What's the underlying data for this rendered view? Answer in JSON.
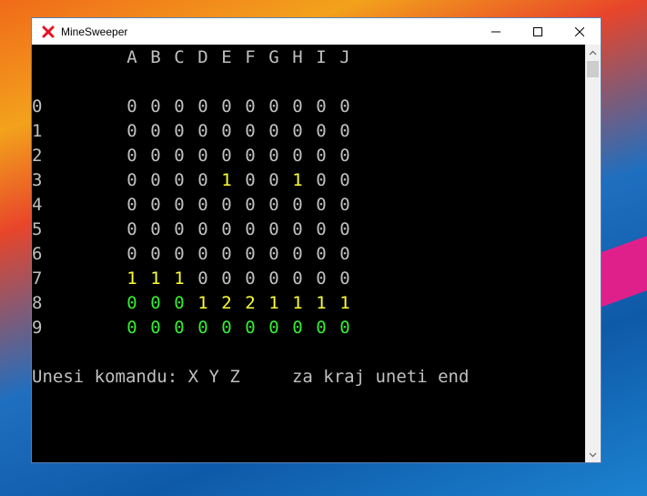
{
  "window": {
    "title": "MineSweeper"
  },
  "columns": [
    "A",
    "B",
    "C",
    "D",
    "E",
    "F",
    "G",
    "H",
    "I",
    "J"
  ],
  "rows": [
    {
      "label": "0",
      "cells": [
        [
          "0",
          "g"
        ],
        [
          "0",
          "g"
        ],
        [
          "0",
          "g"
        ],
        [
          "0",
          "g"
        ],
        [
          "0",
          "g"
        ],
        [
          "0",
          "g"
        ],
        [
          "0",
          "g"
        ],
        [
          "0",
          "g"
        ],
        [
          "0",
          "g"
        ],
        [
          "0",
          "g"
        ]
      ]
    },
    {
      "label": "1",
      "cells": [
        [
          "0",
          "g"
        ],
        [
          "0",
          "g"
        ],
        [
          "0",
          "g"
        ],
        [
          "0",
          "g"
        ],
        [
          "0",
          "g"
        ],
        [
          "0",
          "g"
        ],
        [
          "0",
          "g"
        ],
        [
          "0",
          "g"
        ],
        [
          "0",
          "g"
        ],
        [
          "0",
          "g"
        ]
      ]
    },
    {
      "label": "2",
      "cells": [
        [
          "0",
          "g"
        ],
        [
          "0",
          "g"
        ],
        [
          "0",
          "g"
        ],
        [
          "0",
          "g"
        ],
        [
          "0",
          "g"
        ],
        [
          "0",
          "g"
        ],
        [
          "0",
          "g"
        ],
        [
          "0",
          "g"
        ],
        [
          "0",
          "g"
        ],
        [
          "0",
          "g"
        ]
      ]
    },
    {
      "label": "3",
      "cells": [
        [
          "0",
          "g"
        ],
        [
          "0",
          "g"
        ],
        [
          "0",
          "g"
        ],
        [
          "0",
          "g"
        ],
        [
          "1",
          "y"
        ],
        [
          "0",
          "g"
        ],
        [
          "0",
          "g"
        ],
        [
          "1",
          "y"
        ],
        [
          "0",
          "g"
        ],
        [
          "0",
          "g"
        ]
      ]
    },
    {
      "label": "4",
      "cells": [
        [
          "0",
          "g"
        ],
        [
          "0",
          "g"
        ],
        [
          "0",
          "g"
        ],
        [
          "0",
          "g"
        ],
        [
          "0",
          "g"
        ],
        [
          "0",
          "g"
        ],
        [
          "0",
          "g"
        ],
        [
          "0",
          "g"
        ],
        [
          "0",
          "g"
        ],
        [
          "0",
          "g"
        ]
      ]
    },
    {
      "label": "5",
      "cells": [
        [
          "0",
          "g"
        ],
        [
          "0",
          "g"
        ],
        [
          "0",
          "g"
        ],
        [
          "0",
          "g"
        ],
        [
          "0",
          "g"
        ],
        [
          "0",
          "g"
        ],
        [
          "0",
          "g"
        ],
        [
          "0",
          "g"
        ],
        [
          "0",
          "g"
        ],
        [
          "0",
          "g"
        ]
      ]
    },
    {
      "label": "6",
      "cells": [
        [
          "0",
          "g"
        ],
        [
          "0",
          "g"
        ],
        [
          "0",
          "g"
        ],
        [
          "0",
          "g"
        ],
        [
          "0",
          "g"
        ],
        [
          "0",
          "g"
        ],
        [
          "0",
          "g"
        ],
        [
          "0",
          "g"
        ],
        [
          "0",
          "g"
        ],
        [
          "0",
          "g"
        ]
      ]
    },
    {
      "label": "7",
      "cells": [
        [
          "1",
          "y"
        ],
        [
          "1",
          "y"
        ],
        [
          "1",
          "y"
        ],
        [
          "0",
          "g"
        ],
        [
          "0",
          "g"
        ],
        [
          "0",
          "g"
        ],
        [
          "0",
          "g"
        ],
        [
          "0",
          "g"
        ],
        [
          "0",
          "g"
        ],
        [
          "0",
          "g"
        ]
      ]
    },
    {
      "label": "8",
      "cells": [
        [
          "0",
          "n"
        ],
        [
          "0",
          "n"
        ],
        [
          "0",
          "n"
        ],
        [
          "1",
          "y"
        ],
        [
          "2",
          "y"
        ],
        [
          "2",
          "y"
        ],
        [
          "1",
          "y"
        ],
        [
          "1",
          "y"
        ],
        [
          "1",
          "y"
        ],
        [
          "1",
          "y"
        ]
      ]
    },
    {
      "label": "9",
      "cells": [
        [
          "0",
          "n"
        ],
        [
          "0",
          "n"
        ],
        [
          "0",
          "n"
        ],
        [
          "0",
          "n"
        ],
        [
          "0",
          "n"
        ],
        [
          "0",
          "n"
        ],
        [
          "0",
          "n"
        ],
        [
          "0",
          "n"
        ],
        [
          "0",
          "n"
        ],
        [
          "0",
          "n"
        ]
      ]
    }
  ],
  "prompt": "Unesi komandu: X Y Z     za kraj uneti end",
  "colors": {
    "g": "#c0c0c0",
    "y": "#ffff33",
    "n": "#33ee33"
  }
}
